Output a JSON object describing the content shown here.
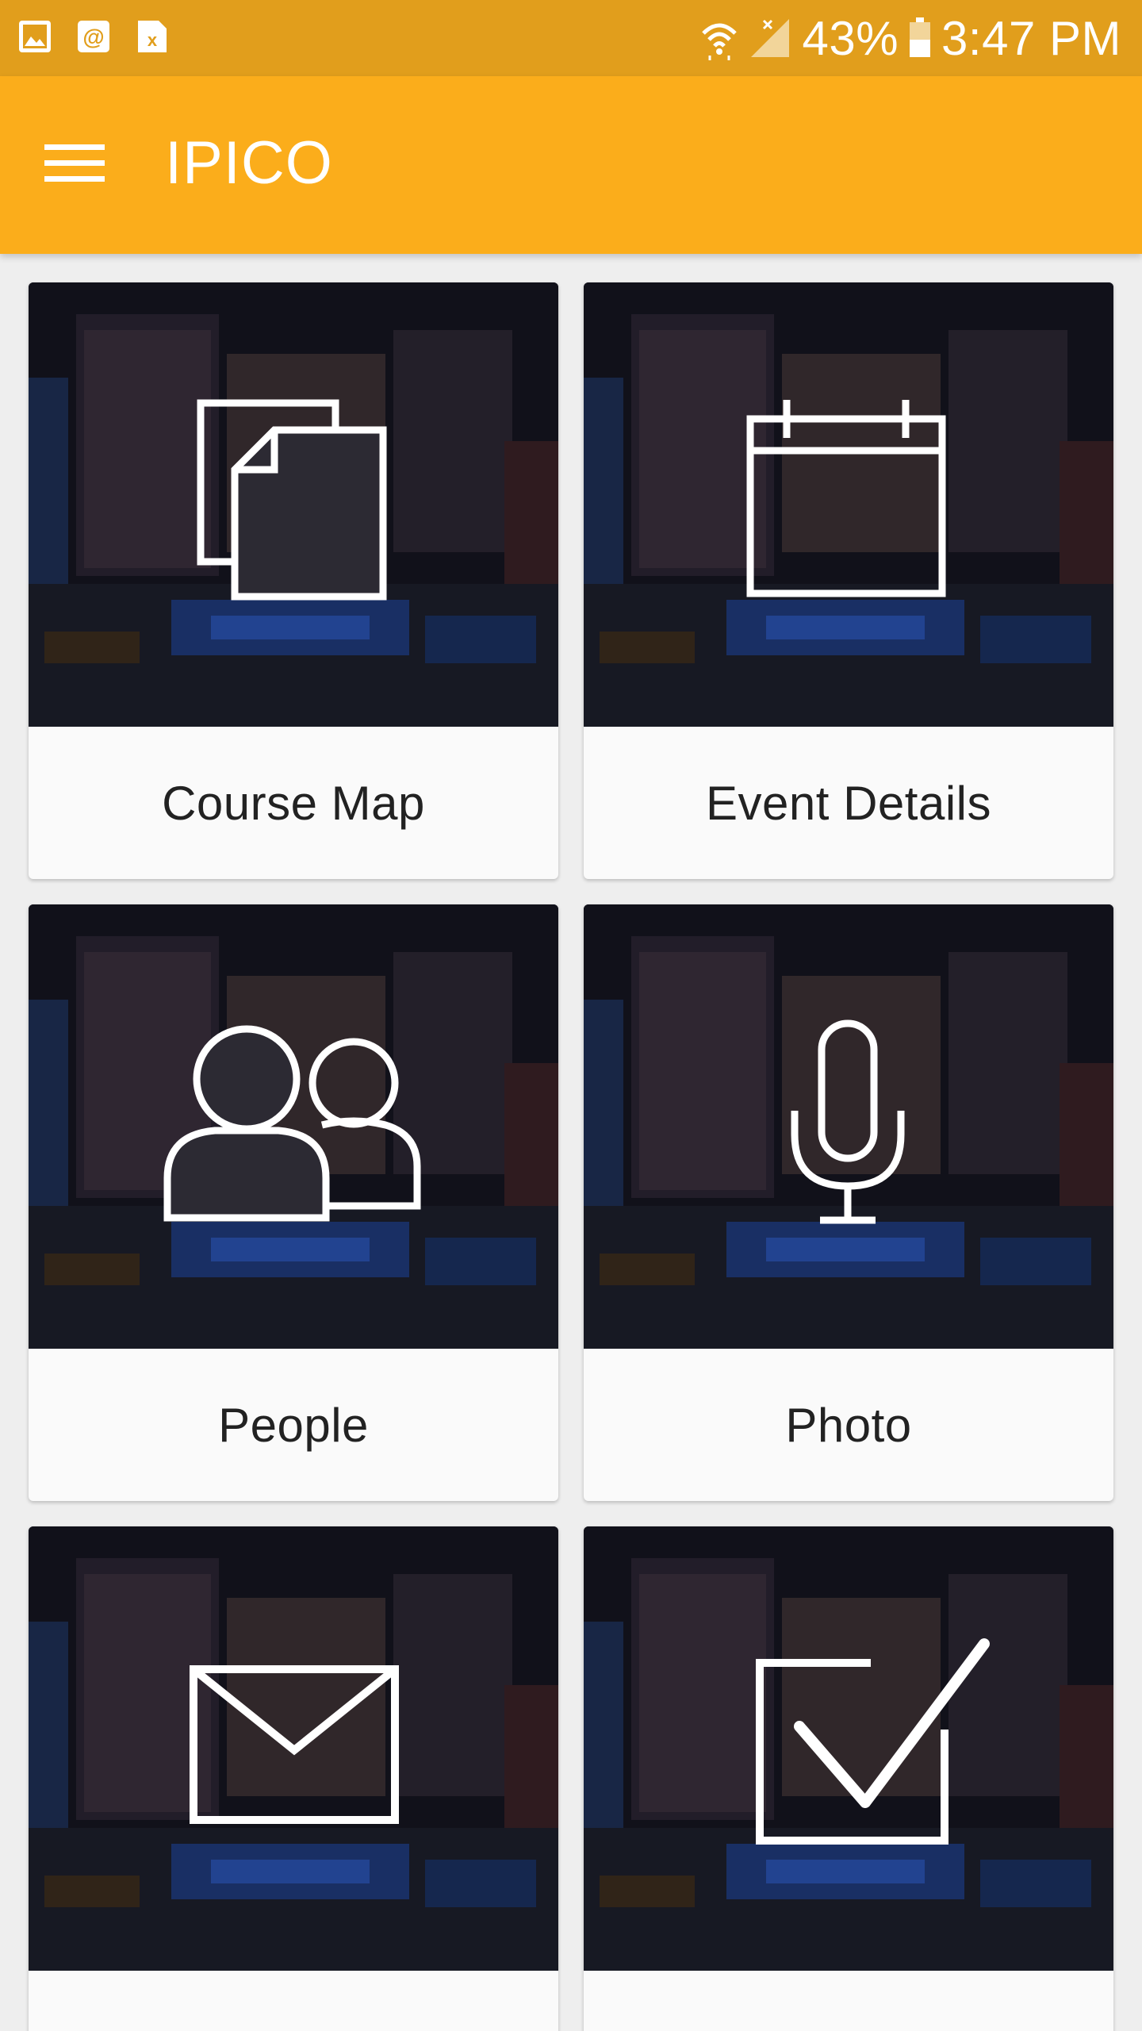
{
  "status_bar": {
    "battery_percent": "43%",
    "time": "3:47 PM",
    "left_icons": [
      "image-notification-icon",
      "email-notification-icon",
      "excel-notification-icon"
    ],
    "right_icons": [
      "wifi-icon",
      "cell-signal-icon",
      "battery-icon"
    ]
  },
  "app_bar": {
    "title": "IPICO",
    "menu_icon": "hamburger-menu-icon",
    "background": "#fbad1b"
  },
  "colors": {
    "status_bar": "#e19e1c",
    "app_bar": "#fbad1b",
    "card_footer": "#fafafa",
    "label_text": "#222222"
  },
  "tiles": [
    {
      "label": "Course Map",
      "icon": "documents-icon"
    },
    {
      "label": "Event Details",
      "icon": "calendar-icon"
    },
    {
      "label": "People",
      "icon": "people-icon"
    },
    {
      "label": "Photo",
      "icon": "microphone-icon"
    },
    {
      "label": "",
      "icon": "envelope-icon"
    },
    {
      "label": "",
      "icon": "checkbox-icon"
    }
  ]
}
